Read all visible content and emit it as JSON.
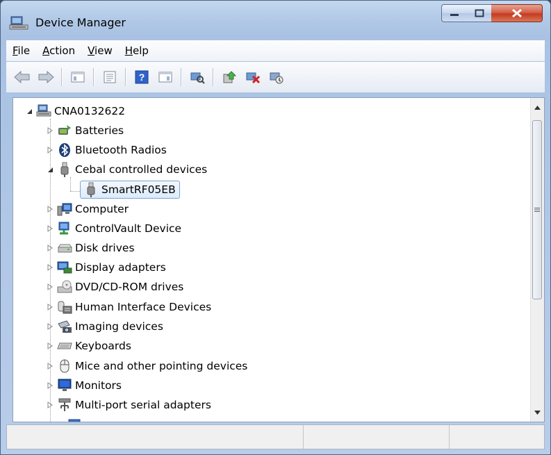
{
  "window": {
    "title": "Device Manager",
    "title_icon": "device-manager-icon"
  },
  "caption_buttons": {
    "minimize": "minimize-icon",
    "maximize": "maximize-icon",
    "close": "close-icon"
  },
  "menu": [
    {
      "label": "File",
      "accel": "F",
      "rest": "ile"
    },
    {
      "label": "Action",
      "accel": "A",
      "rest": "ction"
    },
    {
      "label": "View",
      "accel": "V",
      "rest": "iew"
    },
    {
      "label": "Help",
      "accel": "H",
      "rest": "elp"
    }
  ],
  "toolbar": [
    "back-arrow-icon",
    "forward-arrow-icon",
    "show-hide-console-tree-icon",
    "properties-icon",
    "help-icon",
    "show-action-pane-icon",
    "scan-hardware-icon",
    "update-driver-icon",
    "uninstall-device-icon",
    "disable-device-icon"
  ],
  "tree": {
    "root": {
      "label": "CNA0132622",
      "icon": "computer-network-icon",
      "expanded": true
    },
    "items": [
      {
        "label": "Batteries",
        "icon": "battery-icon",
        "expanded": false
      },
      {
        "label": "Bluetooth Radios",
        "icon": "bluetooth-icon",
        "expanded": false
      },
      {
        "label": "Cebal controlled devices",
        "icon": "usb-plug-icon",
        "expanded": true,
        "children": [
          {
            "label": "SmartRF05EB",
            "icon": "usb-plug-icon",
            "selected": true
          }
        ]
      },
      {
        "label": "Computer",
        "icon": "computer-icon",
        "expanded": false
      },
      {
        "label": "ControlVault Device",
        "icon": "controlvault-icon",
        "expanded": false
      },
      {
        "label": "Disk drives",
        "icon": "disk-drive-icon",
        "expanded": false
      },
      {
        "label": "Display adapters",
        "icon": "display-adapter-icon",
        "expanded": false
      },
      {
        "label": "DVD/CD-ROM drives",
        "icon": "dvd-drive-icon",
        "expanded": false
      },
      {
        "label": "Human Interface Devices",
        "icon": "hid-icon",
        "expanded": false
      },
      {
        "label": "Imaging devices",
        "icon": "camera-icon",
        "expanded": false
      },
      {
        "label": "Keyboards",
        "icon": "keyboard-icon",
        "expanded": false
      },
      {
        "label": "Mice and other pointing devices",
        "icon": "mouse-icon",
        "expanded": false
      },
      {
        "label": "Monitors",
        "icon": "monitor-icon",
        "expanded": false
      },
      {
        "label": "Multi-port serial adapters",
        "icon": "serial-adapter-icon",
        "expanded": false
      }
    ]
  },
  "status_panes": [
    "",
    "",
    ""
  ]
}
